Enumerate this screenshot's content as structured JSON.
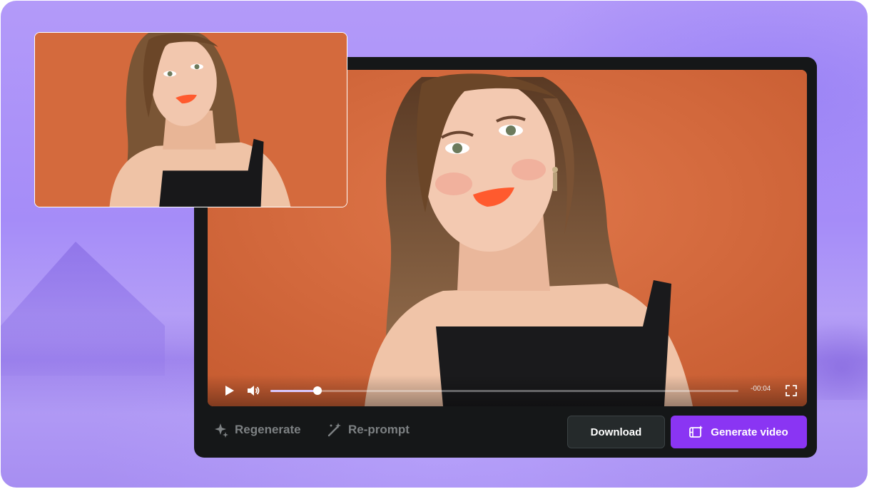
{
  "player": {
    "time_remaining": "-00:04",
    "progress": 0.1,
    "icons": [
      "play-icon",
      "volume-icon",
      "fullscreen-icon"
    ]
  },
  "actions": {
    "regenerate_label": "Regenerate",
    "reprompt_label": "Re-prompt",
    "download_label": "Download",
    "generate_label": "Generate video"
  },
  "colors": {
    "accent": "#8a35f3",
    "panel": "#151718",
    "download_bg": "#252a2b",
    "background": "#a58cf8",
    "video_bg": "#d96e40"
  }
}
